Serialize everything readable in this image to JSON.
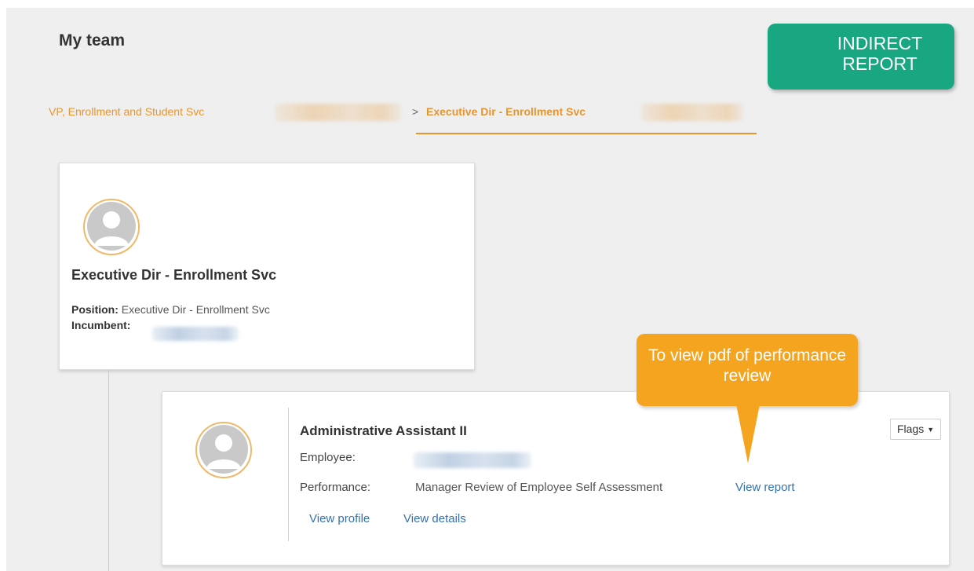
{
  "page": {
    "title": "My team"
  },
  "breadcrumb": {
    "items": [
      {
        "label": "VP, Enrollment and Student Svc"
      },
      {
        "label": "Executive Dir - Enrollment Svc",
        "active": true
      }
    ],
    "separator": ">"
  },
  "annotations": {
    "indirect_report": "INDIRECT REPORT",
    "pdf_callout": "To view pdf of performance review"
  },
  "manager_card": {
    "title": "Executive Dir - Enrollment Svc",
    "position_label": "Position:",
    "position_value": "Executive Dir - Enrollment Svc",
    "incumbent_label": "Incumbent:",
    "avatar_icon": "user-silhouette-icon"
  },
  "employee_card": {
    "title": "Administrative Assistant II",
    "employee_label": "Employee:",
    "performance_label": "Performance:",
    "performance_value": "Manager Review of Employee Self Assessment",
    "view_report": "View report",
    "view_profile": "View profile",
    "view_details": "View details",
    "flags_label": "Flags",
    "avatar_icon": "user-silhouette-icon"
  },
  "colors": {
    "accent_orange": "#e8952e",
    "link_blue": "#3471b0",
    "callout_green": "#18a781",
    "callout_orange": "#f4a41f"
  }
}
